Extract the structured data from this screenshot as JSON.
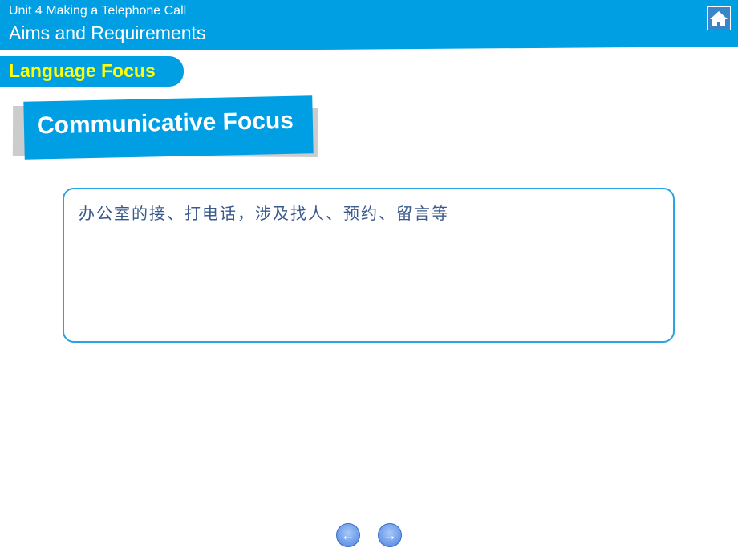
{
  "header": {
    "unit": "Unit 4 Making a Telephone Call",
    "title": "Aims and Requirements",
    "home_icon": "home-icon"
  },
  "section": "Language Focus",
  "subsection": "Communicative Focus",
  "content": "办公室的接、打电话，涉及找人、预约、留言等",
  "nav": {
    "prev": "←",
    "next": "→"
  },
  "colors": {
    "brand": "#009fe3",
    "section_text": "#ffff00"
  }
}
